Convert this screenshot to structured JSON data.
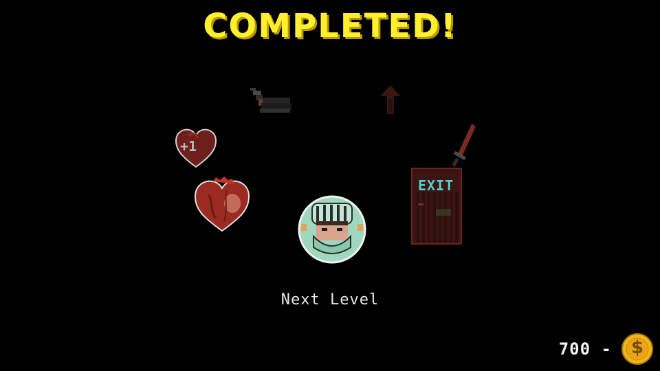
{
  "screen": {
    "title": "COMPLETED!",
    "next_level_label": "Next Level",
    "bonus_heart_label": "+1",
    "exit_sign": "EXIT"
  },
  "hud": {
    "coins": "700",
    "coin_separator": "-",
    "coin_symbol": "$"
  },
  "icons": {
    "boot": "boot-icon",
    "up_arrow": "up-arrow-icon",
    "bonus_heart": "heart-plus-one-icon",
    "heart": "heart-icon",
    "player": "knight-helmet-avatar",
    "exit_door": "exit-door-icon",
    "sword": "sword-icon",
    "coin": "coin-icon"
  },
  "colors": {
    "title": "#ffef2e",
    "background": "#000000",
    "coin": "#f2b51e",
    "exit_sign": "#4fd3d3"
  }
}
